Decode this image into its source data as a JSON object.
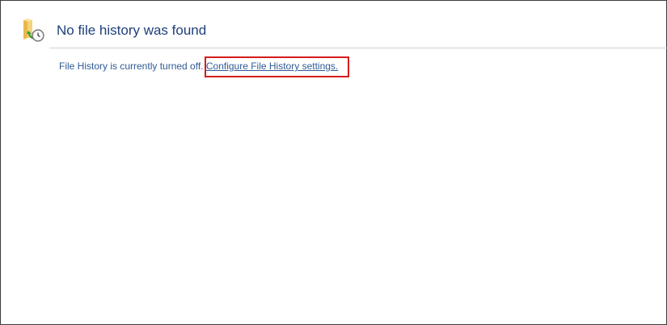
{
  "header": {
    "title": "No file history was found",
    "icon": "folder-history-icon"
  },
  "status": {
    "message": "File History is currently turned off.",
    "link_label": "Configure File History settings."
  },
  "colors": {
    "title": "#1e3f7a",
    "text": "#2f5a96",
    "highlight": "#d61c1c"
  }
}
